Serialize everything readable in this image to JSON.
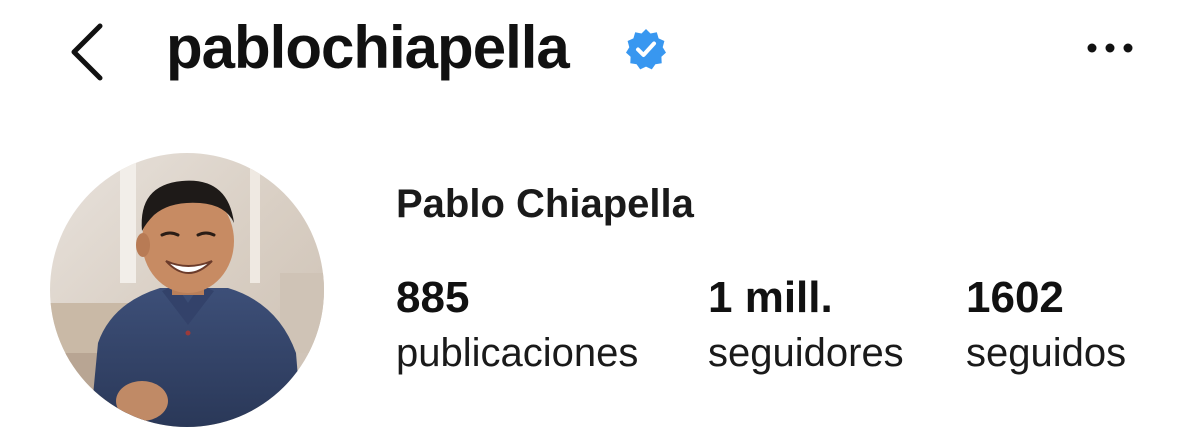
{
  "header": {
    "username": "pablochiapella",
    "verified": true,
    "back_icon": "chevron-left-icon",
    "more_icon": "more-horizontal-icon",
    "verified_color": "#3897f0"
  },
  "profile": {
    "full_name": "Pablo Chiapella",
    "avatar": "profile-photo"
  },
  "stats": {
    "posts": {
      "value": "885",
      "label": "publicaciones"
    },
    "followers": {
      "value": "1 mill.",
      "label": "seguidores"
    },
    "following": {
      "value": "1602",
      "label": "seguidos"
    }
  }
}
